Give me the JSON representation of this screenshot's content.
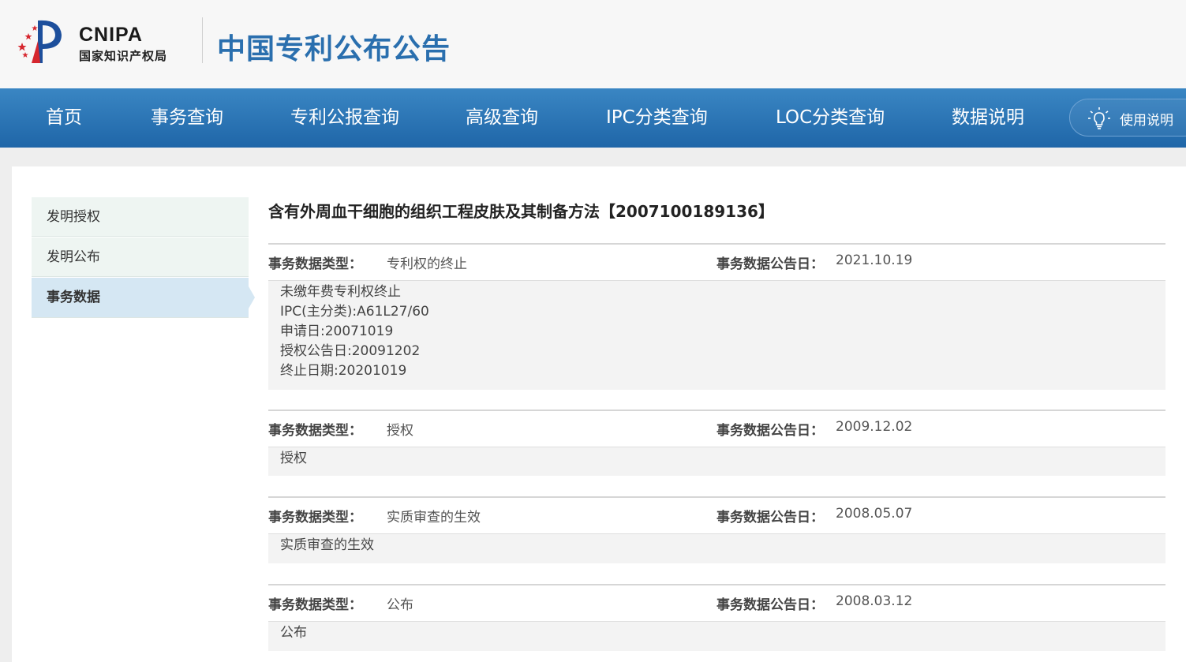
{
  "header": {
    "brand_en": "CNIPA",
    "brand_cn": "国家知识产权局",
    "site_title": "中国专利公布公告",
    "logo_colors": {
      "star": "#d6262e",
      "mark": "#1d4f9c"
    }
  },
  "nav": {
    "items": [
      {
        "label": "首页"
      },
      {
        "label": "事务查询"
      },
      {
        "label": "专利公报查询"
      },
      {
        "label": "高级查询"
      },
      {
        "label": "IPC分类查询"
      },
      {
        "label": "LOC分类查询"
      },
      {
        "label": "数据说明"
      }
    ],
    "help": {
      "label": "使用说明",
      "icon": "lightbulb-icon"
    }
  },
  "sidebar": {
    "items": [
      {
        "label": "发明授权",
        "active": false
      },
      {
        "label": "发明公布",
        "active": false
      },
      {
        "label": "事务数据",
        "active": true
      }
    ]
  },
  "patent": {
    "title": "含有外周血干细胞的组织工程皮肤及其制备方法【2007100189136】"
  },
  "records": [
    {
      "type_label": "事务数据类型：",
      "type_value": "专利权的终止",
      "date_label": "事务数据公告日：",
      "date_value": "2021.10.19",
      "lines": [
        "未缴年费专利权终止",
        "IPC(主分类):A61L27/60",
        "申请日:20071019",
        "授权公告日:20091202",
        "终止日期:20201019"
      ]
    },
    {
      "type_label": "事务数据类型：",
      "type_value": "授权",
      "date_label": "事务数据公告日：",
      "date_value": "2009.12.02",
      "lines": [
        "授权"
      ]
    },
    {
      "type_label": "事务数据类型：",
      "type_value": "实质审查的生效",
      "date_label": "事务数据公告日：",
      "date_value": "2008.05.07",
      "lines": [
        "实质审查的生效"
      ]
    },
    {
      "type_label": "事务数据类型：",
      "type_value": "公布",
      "date_label": "事务数据公告日：",
      "date_value": "2008.03.12",
      "lines": [
        "公布"
      ]
    }
  ]
}
